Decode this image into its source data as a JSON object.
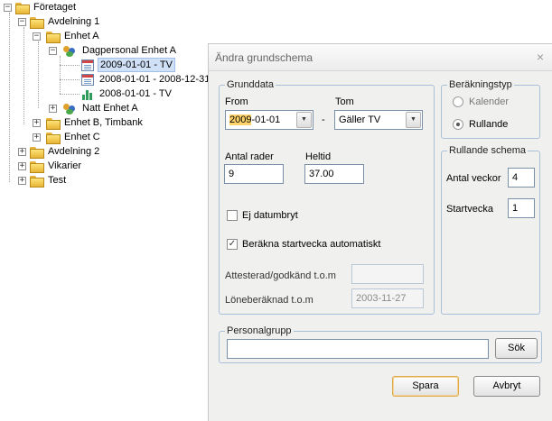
{
  "tree": {
    "nodes": [
      {
        "label": "Företaget",
        "icon": "folder-icon"
      },
      {
        "label": "Avdelning 1",
        "icon": "folder-icon"
      },
      {
        "label": "Enhet A",
        "icon": "folder-icon"
      },
      {
        "label": "Dagpersonal Enhet A",
        "icon": "people-icon"
      },
      {
        "label": "2009-01-01 - TV",
        "icon": "schedule-icon",
        "selected": true
      },
      {
        "label": "2008-01-01 - 2008-12-31",
        "icon": "schedule-icon"
      },
      {
        "label": "2008-01-01 - TV",
        "icon": "chart-icon"
      },
      {
        "label": "Natt Enhet A",
        "icon": "people-icon"
      },
      {
        "label": "Enhet B, Timbank",
        "icon": "folder-icon"
      },
      {
        "label": "Enhet C",
        "icon": "folder-icon"
      },
      {
        "label": "Avdelning 2",
        "icon": "folder-icon"
      },
      {
        "label": "Vikarier",
        "icon": "folder-icon"
      },
      {
        "label": "Test",
        "icon": "folder-icon"
      }
    ],
    "expand_collapsed": "+",
    "expand_open": "−"
  },
  "dialog": {
    "title": "Ändra grundschema",
    "close": "×",
    "grunddata": {
      "legend": "Grunddata",
      "from_label": "From",
      "from_year": "2009",
      "from_rest": "-01-01",
      "dash": "-",
      "tom_label": "Tom",
      "tom_value": "Gäller TV",
      "antal_rader_label": "Antal rader",
      "antal_rader_value": "9",
      "heltid_label": "Heltid",
      "heltid_value": "37.00",
      "ej_datumbryt_label": "Ej datumbryt",
      "ej_datumbryt_checked": false,
      "berakna_label": "Beräkna startvecka automatiskt",
      "berakna_checked": true,
      "attesterad_label": "Attesterad/godkänd t.o.m",
      "attesterad_value": "",
      "lonebe_label": "Löneberäknad t.o.m",
      "lonebe_value": "2003-11-27"
    },
    "berakningstyp": {
      "legend": "Beräkningstyp",
      "kalender_label": "Kalender",
      "rullande_label": "Rullande",
      "selected": "Rullande"
    },
    "rullande_schema": {
      "legend": "Rullande schema",
      "antal_veckor_label": "Antal veckor",
      "antal_veckor_value": "4",
      "startvecka_label": "Startvecka",
      "startvecka_value": "1"
    },
    "personalgrupp": {
      "legend": "Personalgrupp",
      "value": "",
      "sok_label": "Sök"
    },
    "spara_label": "Spara",
    "avbryt_label": "Avbryt",
    "combo_arrow": "▼",
    "check_mark": "✓"
  }
}
